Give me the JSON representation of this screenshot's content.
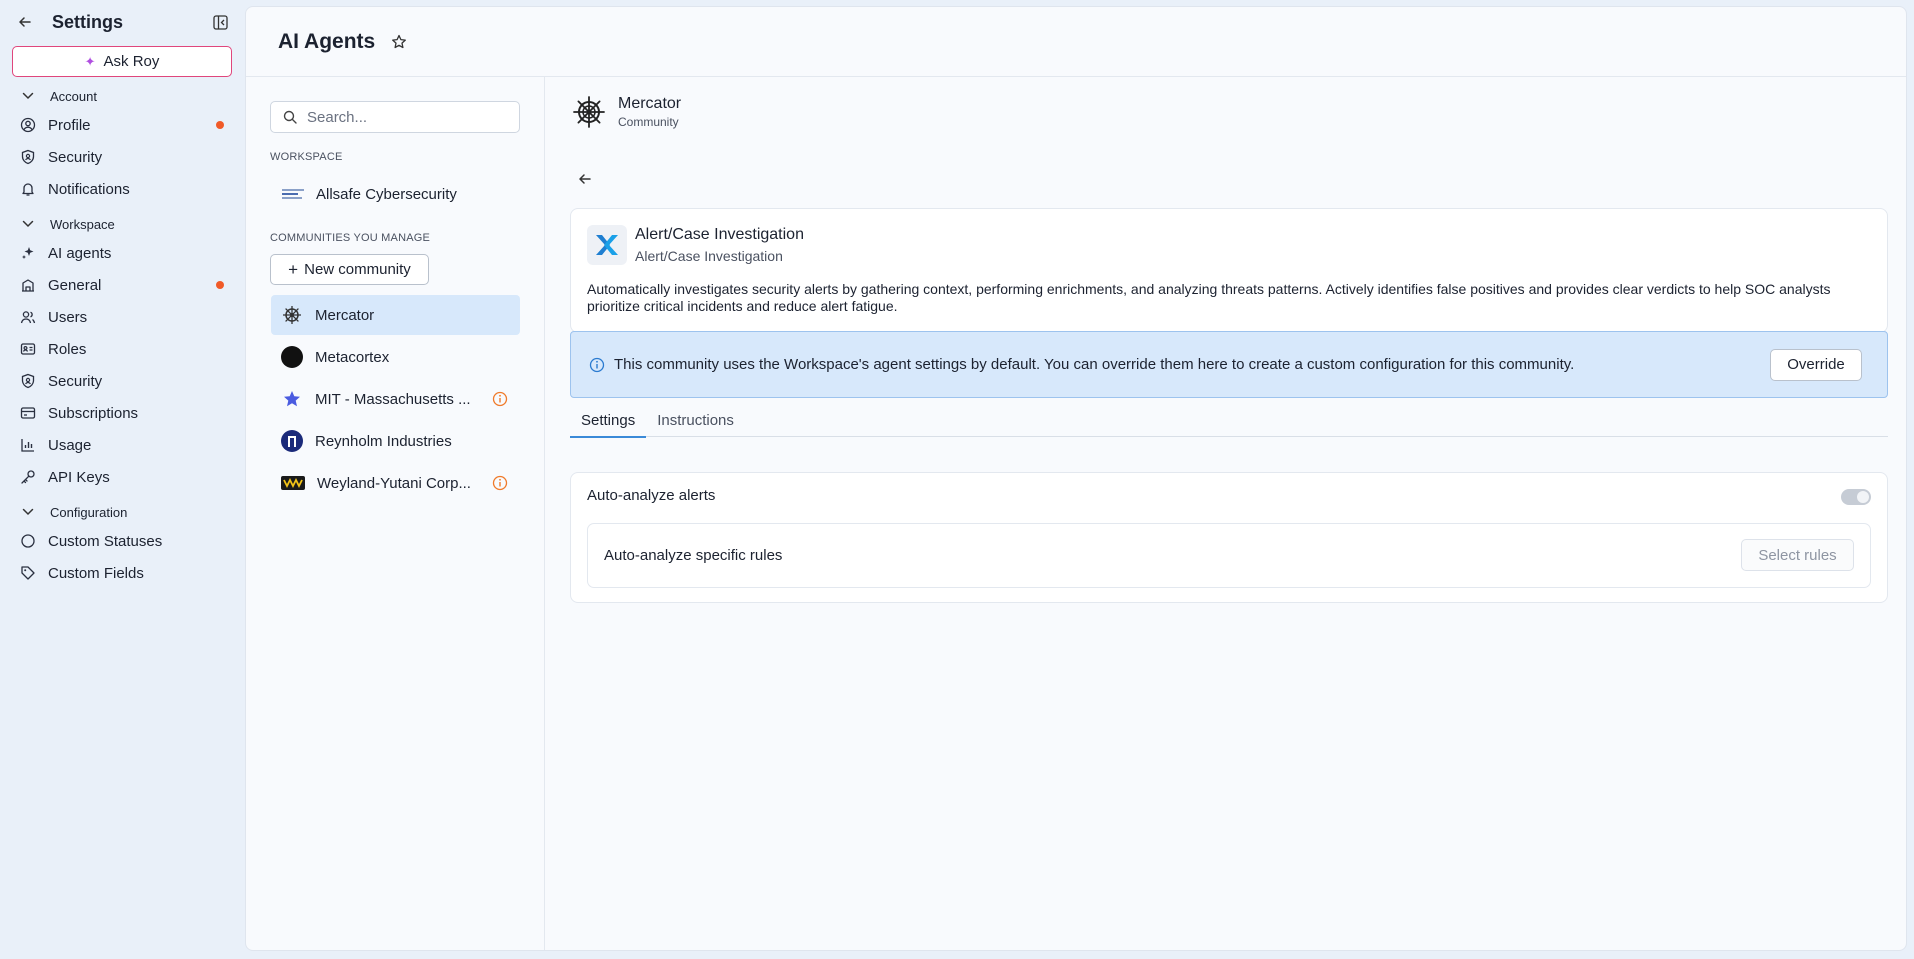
{
  "sidebar": {
    "title": "Settings",
    "ask_button": "Ask Roy",
    "sections": {
      "account": "Account",
      "workspace": "Workspace",
      "configuration": "Configuration"
    },
    "items": {
      "profile": "Profile",
      "account_security": "Security",
      "notifications": "Notifications",
      "ai_agents": "AI agents",
      "general": "General",
      "users": "Users",
      "roles": "Roles",
      "workspace_security": "Security",
      "subscriptions": "Subscriptions",
      "usage": "Usage",
      "api_keys": "API Keys",
      "custom_statuses": "Custom Statuses",
      "custom_fields": "Custom Fields"
    }
  },
  "header": {
    "title": "AI Agents"
  },
  "communities_panel": {
    "search_placeholder": "Search...",
    "workspace_label": "WORKSPACE",
    "workspace_name": "Allsafe Cybersecurity",
    "communities_label": "COMMUNITIES YOU MANAGE",
    "new_community": "New community",
    "communities": [
      {
        "name": "Mercator",
        "active": true
      },
      {
        "name": "Metacortex"
      },
      {
        "name": "MIT - Massachusetts ...",
        "warning": true
      },
      {
        "name": "Reynholm Industries"
      },
      {
        "name": "Weyland-Yutani Corp...",
        "warning": true
      }
    ]
  },
  "detail": {
    "community_name": "Mercator",
    "community_type": "Community",
    "agent": {
      "title": "Alert/Case Investigation",
      "subtitle": "Alert/Case Investigation",
      "description": "Automatically investigates security alerts by gathering context, performing enrichments, and analyzing threats patterns. Actively identifies false positives and provides clear verdicts to help SOC analysts prioritize critical incidents and reduce alert fatigue."
    },
    "banner": {
      "text": "This community uses the Workspace's agent settings by default. You can override them here to create a custom configuration for this community.",
      "button": "Override"
    },
    "tabs": [
      "Settings",
      "Instructions"
    ],
    "settings": {
      "auto_analyze_label": "Auto-analyze alerts",
      "auto_analyze_enabled": false,
      "specific_rules_label": "Auto-analyze specific rules",
      "select_rules_button": "Select rules"
    }
  },
  "colors": {
    "accent": "#3b8ad8",
    "notification_dot": "#f05a28",
    "banner_bg": "#d7e8fb",
    "ask_roy_border": "#e0467c"
  }
}
